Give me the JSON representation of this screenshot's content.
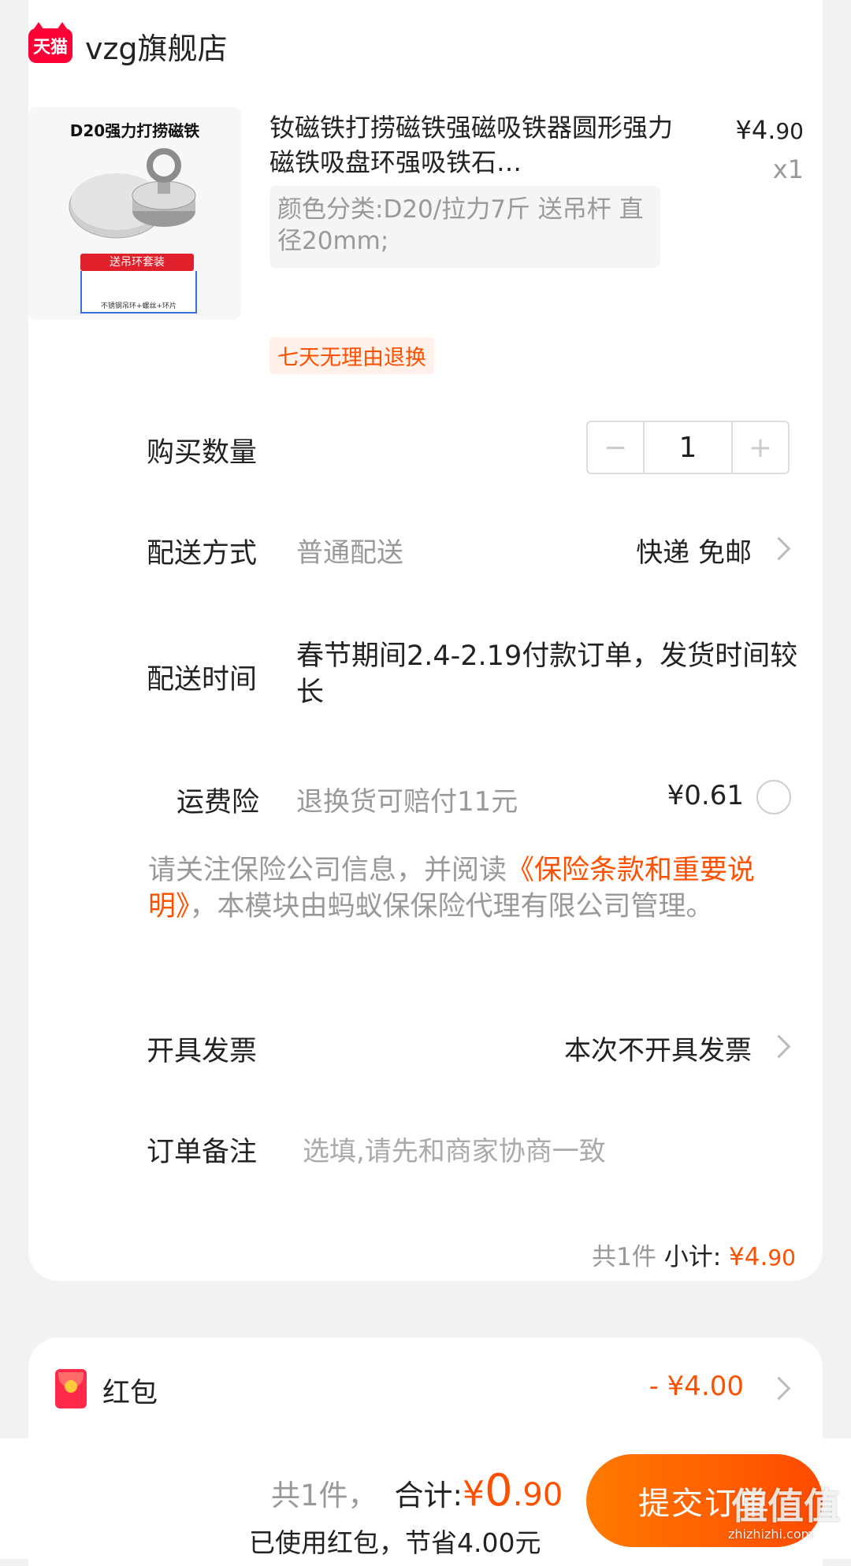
{
  "shop": {
    "logo_text": "天猫",
    "name": "vzg旗舰店"
  },
  "product": {
    "image_title": "D20强力打捞磁铁",
    "image_band": "送吊环套装",
    "image_caption": "不锈钢吊环+螺丝+环片",
    "title": "钕磁铁打捞磁铁强磁吸铁器圆形强力磁铁吸盘环强吸铁石…",
    "price_symbol": "¥",
    "price_int": "4.",
    "price_cents": "90",
    "qty": "x1",
    "spec": "颜色分类:D20/拉力7斤  送吊杆 直径20mm;",
    "return_tag": "七天无理由退换"
  },
  "quantity": {
    "label": "购买数量",
    "minus": "−",
    "value": "1",
    "plus": "+"
  },
  "shipping": {
    "label": "配送方式",
    "method": "普通配送",
    "value": "快递 免邮"
  },
  "delivery_time": {
    "label": "配送时间",
    "value": "春节期间2.4-2.19付款订单，发货时间较长"
  },
  "insurance": {
    "label": "运费险",
    "desc": "退换货可赔付11元",
    "price": "¥0.61"
  },
  "notice": {
    "pre": "请关注保险公司信息，并阅读",
    "link": "《保险条款和重要说明》",
    "post": "，本模块由蚂蚁保保险代理有限公司管理。"
  },
  "invoice": {
    "label": "开具发票",
    "value": "本次不开具发票"
  },
  "remark": {
    "label": "订单备注",
    "placeholder": "选填,请先和商家协商一致"
  },
  "subtotal": {
    "count": "共1件",
    "label": "小计:",
    "symbol": "¥",
    "int": "4.",
    "cents": "90"
  },
  "red_packet": {
    "label": "红包",
    "value": "- ¥4.00"
  },
  "footer": {
    "count": "共1件，",
    "total_label": "合计:",
    "symbol": "¥",
    "int": "0",
    "cents": ".90",
    "saved": "已使用红包，节省4.00元",
    "submit": "提交订单"
  },
  "watermark": {
    "logo": "值值值",
    "url": "zhizhizhi.com"
  },
  "colors": {
    "accent": "#ff5000",
    "tmall": "#ff0036",
    "background": "#f2f2f2"
  }
}
